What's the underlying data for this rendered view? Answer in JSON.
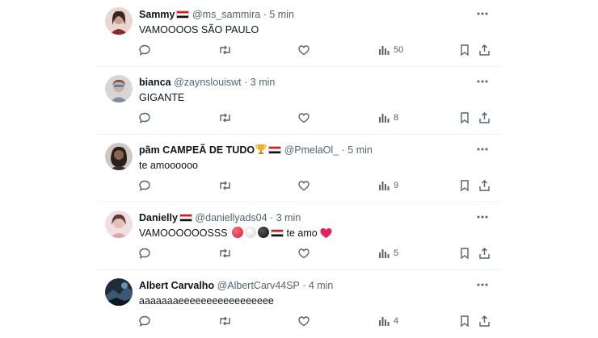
{
  "posts": [
    {
      "name": "Sammy",
      "handle": "@ms_sammira",
      "time": "5 min",
      "text": "VAMOOOOS SÃO PAULO",
      "views": "50",
      "avatar_color": "#c9a090"
    },
    {
      "name": "bianca",
      "handle": "@zaynslouiswt",
      "time": "3 min",
      "text": "GIGANTE",
      "views": "8",
      "avatar_color": "#b9a6a0"
    },
    {
      "name": "pãm CAMPEÃ DE TUDO",
      "handle": "@PmelaOl_",
      "time": "5 min",
      "text": "te amoooooo",
      "views": "9",
      "avatar_color": "#3a2f2b"
    },
    {
      "name": "Danielly",
      "handle": "@daniellyads04",
      "time": "3 min",
      "text_before": "VAMOOOOOOSSS",
      "text_after": "te amo",
      "views": "5",
      "avatar_color": "#d8a8b0"
    },
    {
      "name": "Albert Carvalho",
      "handle": "@AlbertCarv44SP",
      "time": "4 min",
      "text": "aaaaaaaeeeeeeeeeeeeeeeee",
      "views": "4",
      "avatar_color": "#2b3a4a"
    }
  ],
  "separator": "·",
  "colors": {
    "text": "#0f1419",
    "secondary": "#536471",
    "divider": "#eff3f4",
    "flag_red": "#d71920"
  }
}
